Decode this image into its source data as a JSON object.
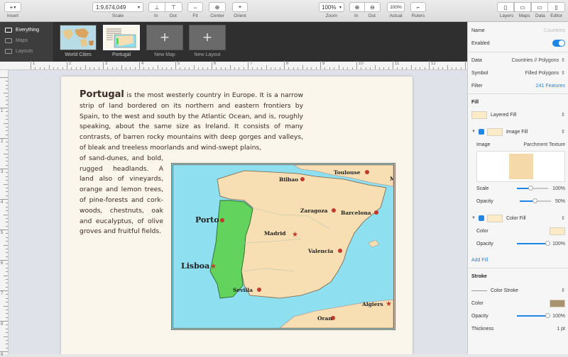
{
  "toolbar": {
    "insert_label": "Insert",
    "scale_value": "1:9,674,049",
    "scale_label": "Scale",
    "in_label": "In",
    "out_label": "Out",
    "fit_label": "Fit",
    "center_label": "Center",
    "orient_label": "Orient",
    "zoom_value": "100%",
    "zoom_label": "Zoom",
    "zoom_in_label": "In",
    "zoom_out_label": "Out",
    "actual_btn": "100%",
    "actual_label": "Actual",
    "rulers_label": "Rulers",
    "layers_label": "Layers",
    "maps_label": "Maps",
    "data_label": "Data",
    "editor_label": "Editor"
  },
  "sidebar": {
    "items": [
      {
        "label": "Everything",
        "icon": "layers-icon"
      },
      {
        "label": "Maps",
        "icon": "map-icon"
      },
      {
        "label": "Layouts",
        "icon": "layout-icon"
      }
    ]
  },
  "maps": {
    "thumbnails": [
      {
        "label": "World Cities"
      },
      {
        "label": "Portugal"
      },
      {
        "label": "New Map",
        "glyph": "+"
      },
      {
        "label": "New Layout",
        "glyph": "+"
      }
    ]
  },
  "ruler": {
    "h_ticks": [
      "1",
      "2",
      "3",
      "4",
      "5",
      "6",
      "7",
      "8",
      "9",
      "10",
      "11",
      "12"
    ],
    "v_ticks": [
      "1",
      "2",
      "3",
      "4",
      "5",
      "6",
      "7",
      "8",
      "9"
    ]
  },
  "article": {
    "title": "Portugal",
    "para1": " is the most westerly country in Europe. It is a narrow strip of land bordered on its northern and eastern frontiers by Spain, to the west and south by the Atlantic Ocean, and is, roughly speaking, about the same size as Ireland. It consists of many contrasts, of barren rocky mountains with deep gorges and valleys, of bleak and treeless moorlands and wind-swept plains,",
    "para2": "of sand-dunes, and bold, rugged headlands. A land also of vineyards, orange and lemon trees, of pine-forests and cork-woods, chestnuts, oak and eucalyptus, of olive groves and fruitful fields."
  },
  "map": {
    "cities": [
      {
        "name": "Toulouse"
      },
      {
        "name": "Bilbao"
      },
      {
        "name": "M"
      },
      {
        "name": "Porto"
      },
      {
        "name": "Zaragoza"
      },
      {
        "name": "Barcelona"
      },
      {
        "name": "Madrid"
      },
      {
        "name": "Lisboa"
      },
      {
        "name": "Valencia"
      },
      {
        "name": "Sevilla"
      },
      {
        "name": "Algiers"
      },
      {
        "name": "Oran"
      }
    ],
    "colors": {
      "sea": "#8ee0f0",
      "land": "#f7deb3",
      "highlight": "#62d35c",
      "city": "#c0392b"
    }
  },
  "inspector": {
    "name_label": "Name",
    "name_placeholder": "Countries",
    "enabled_label": "Enabled",
    "data_label": "Data",
    "data_value": "Countries // Polygons",
    "symbol_label": "Symbol",
    "symbol_value": "Filled Polygons",
    "filter_label": "Filter",
    "filter_value": "241 Features",
    "fill_heading": "Fill",
    "layered_fill": "Layered Fill",
    "image_fill": "Image Fill",
    "image_label": "Image",
    "image_value": "Parchment Texture",
    "scale_label": "Scale",
    "scale_value": "100%",
    "scale_level": 0.45,
    "opacity_label": "Opacity",
    "image_opacity_value": "50%",
    "image_opacity_level": 0.5,
    "color_fill": "Color Fill",
    "color_label": "Color",
    "fill_opacity_value": "100%",
    "fill_opacity_level": 1.0,
    "add_fill": "Add Fill",
    "stroke_heading": "Stroke",
    "color_stroke": "Color Stroke",
    "stroke_color_label": "Color",
    "stroke_opacity_label": "Opacity",
    "stroke_opacity_value": "100%",
    "stroke_opacity_level": 1.0,
    "thickness_label": "Thickness",
    "thickness_value": "1 pt",
    "colors": {
      "accent": "#1f86e8",
      "fill_swatch": "#fcebc7",
      "stroke_swatch": "#a89371"
    }
  }
}
